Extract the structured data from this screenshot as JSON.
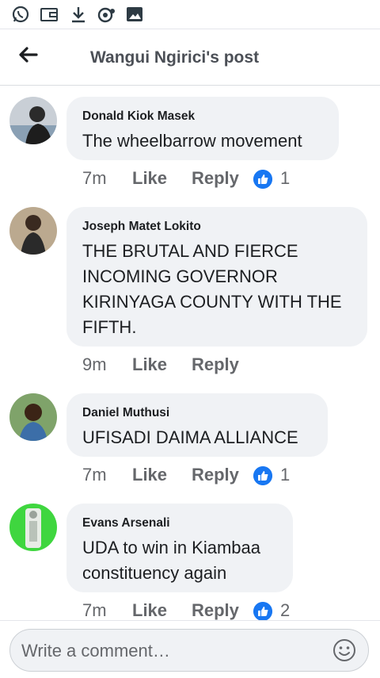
{
  "header": {
    "title": "Wangui Ngirici's post",
    "back_icon": "arrow-left-icon"
  },
  "status_bar": {
    "icons": [
      "whatsapp-icon",
      "wallet-icon",
      "download-icon",
      "data-saver-icon",
      "image-icon"
    ]
  },
  "comments": [
    {
      "author": "Donald Kiok Masek",
      "text": "The wheelbarrow movement",
      "time": "7m",
      "like_label": "Like",
      "reply_label": "Reply",
      "reaction_count": "1"
    },
    {
      "author": "Joseph Matet Lokito",
      "text": "THE BRUTAL AND FIERCE INCOMING GOVERNOR KIRINYAGA COUNTY WITH THE FIFTH.",
      "time": "9m",
      "like_label": "Like",
      "reply_label": "Reply"
    },
    {
      "author": "Daniel Muthusi",
      "text": "UFISADI DAIMA ALLIANCE",
      "time": "7m",
      "like_label": "Like",
      "reply_label": "Reply",
      "reaction_count": "1"
    },
    {
      "author": "Evans Arsenali",
      "text": "UDA to win in Kiambaa constituency again",
      "time": "7m",
      "like_label": "Like",
      "reply_label": "Reply",
      "reaction_count": "2"
    }
  ],
  "composer": {
    "placeholder": "Write a comment…",
    "value": ""
  },
  "colors": {
    "accent": "#1877f2",
    "bubble": "#f0f2f5",
    "whatsapp": "#25d366"
  }
}
